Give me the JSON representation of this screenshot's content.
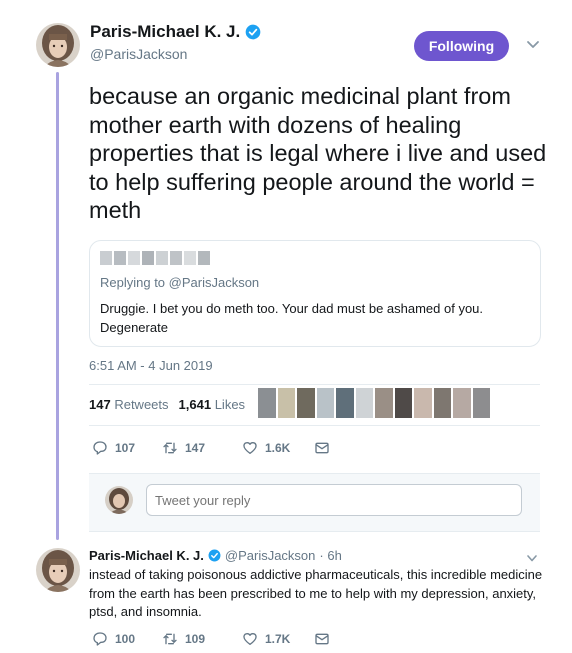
{
  "main_tweet": {
    "author_name": "Paris-Michael K. J.",
    "handle": "@ParisJackson",
    "follow_label": "Following",
    "text": "because an organic medicinal plant from mother earth with dozens of healing properties that is legal where i live and used to help suffering people around the world = meth",
    "quoted": {
      "replying_to": "Replying to @ParisJackson",
      "text": "Druggie. I bet you do meth too. Your dad must be ashamed of you. Degenerate"
    },
    "timestamp": "6:51 AM - 4 Jun 2019",
    "retweets_count": "147",
    "retweets_label": "Retweets",
    "likes_count": "1,641",
    "likes_label": "Likes",
    "actions": {
      "replies": "107",
      "retweets": "147",
      "likes": "1.6K"
    }
  },
  "reply_composer": {
    "placeholder": "Tweet your reply"
  },
  "reply_tweet": {
    "author_name": "Paris-Michael K. J.",
    "handle": "@ParisJackson",
    "time": "· 6h",
    "text": "instead of taking poisonous addictive pharmaceuticals, this incredible medicine from the earth has been prescribed to me to help with my depression, anxiety, ptsd, and insomnia.",
    "actions": {
      "replies": "100",
      "retweets": "109",
      "likes": "1.7K"
    }
  },
  "colors": {
    "accent": "#6e56cf",
    "verified": "#1da1f2",
    "thread_line": "#a9a3e0",
    "muted_text": "#657786"
  }
}
